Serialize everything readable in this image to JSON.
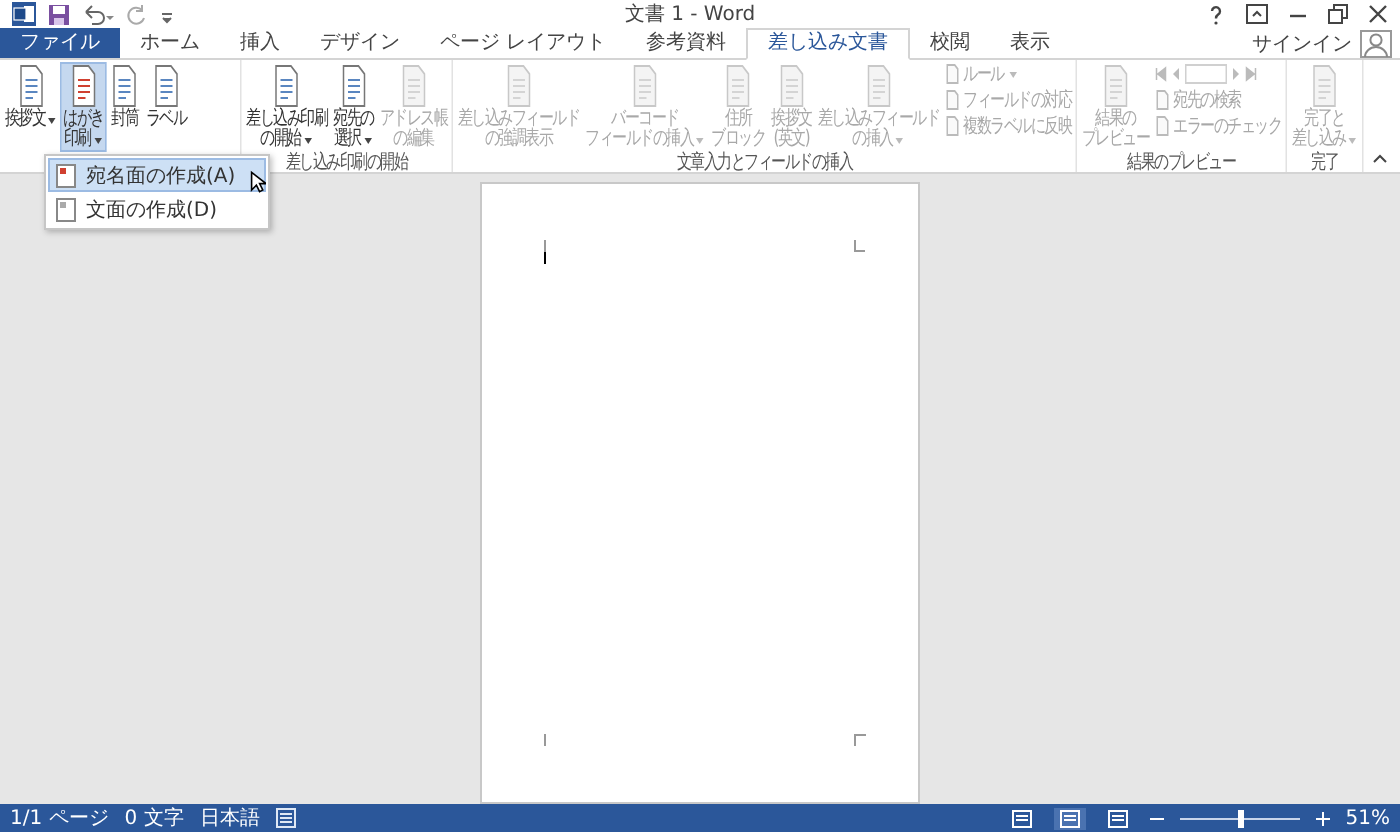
{
  "window": {
    "title": "文書 1 - Word",
    "sign_in": "サインイン"
  },
  "tabs": [
    {
      "label": "ファイル",
      "kind": "file",
      "selected": false
    },
    {
      "label": "ホーム",
      "kind": "tab",
      "selected": false
    },
    {
      "label": "挿入",
      "kind": "tab",
      "selected": false
    },
    {
      "label": "デザイン",
      "kind": "tab",
      "selected": false
    },
    {
      "label": "ページ レイアウト",
      "kind": "tab",
      "selected": false
    },
    {
      "label": "参考資料",
      "kind": "tab",
      "selected": false
    },
    {
      "label": "差し込み文書",
      "kind": "tab",
      "selected": true
    },
    {
      "label": "校閲",
      "kind": "tab",
      "selected": false
    },
    {
      "label": "表示",
      "kind": "tab",
      "selected": false
    }
  ],
  "ribbon": {
    "groups": [
      {
        "items": [
          {
            "kind": "large",
            "lines": [
              "挨拶文"
            ],
            "dropdown": true,
            "disabled": false,
            "selected": false
          },
          {
            "kind": "large",
            "lines": [
              "はがき",
              "印刷"
            ],
            "dropdown": true,
            "disabled": false,
            "selected": true
          },
          {
            "kind": "large",
            "lines": [
              "封筒"
            ],
            "dropdown": false,
            "disabled": false,
            "selected": false
          },
          {
            "kind": "large",
            "lines": [
              "ラベル"
            ],
            "dropdown": false,
            "disabled": false,
            "selected": false
          }
        ]
      },
      {
        "label": "差し込み印刷の開始",
        "items": [
          {
            "kind": "large",
            "lines": [
              "差し込み印刷",
              "の開始"
            ],
            "dropdown": true,
            "disabled": false,
            "selected": false
          },
          {
            "kind": "large",
            "lines": [
              "宛先の",
              "選択"
            ],
            "dropdown": true,
            "disabled": false,
            "selected": false
          },
          {
            "kind": "large",
            "lines": [
              "アドレス帳",
              "の編集"
            ],
            "dropdown": false,
            "disabled": true,
            "selected": false
          }
        ]
      },
      {
        "label": "文章入力とフィールドの挿入",
        "items": [
          {
            "kind": "large",
            "lines": [
              "差し込みフィールド",
              "の強調表示"
            ],
            "dropdown": false,
            "disabled": true,
            "selected": false
          },
          {
            "kind": "large",
            "lines": [
              "バーコード",
              "フィールドの挿入"
            ],
            "dropdown": true,
            "disabled": true,
            "selected": false
          },
          {
            "kind": "large",
            "lines": [
              "住所",
              "ブロック"
            ],
            "dropdown": false,
            "disabled": true,
            "selected": false
          },
          {
            "kind": "large",
            "lines": [
              "挨拶文",
              "(英文)"
            ],
            "dropdown": false,
            "disabled": true,
            "selected": false
          },
          {
            "kind": "large",
            "lines": [
              "差し込みフィールド",
              "の挿入"
            ],
            "dropdown": true,
            "disabled": true,
            "selected": false
          },
          {
            "kind": "stack",
            "entries": [
              {
                "text": "ルール",
                "dropdown": true,
                "disabled": true
              },
              {
                "text": "フィールドの対応",
                "dropdown": false,
                "disabled": true
              },
              {
                "text": "複数ラベルに反映",
                "dropdown": false,
                "disabled": true
              }
            ]
          }
        ]
      },
      {
        "label": "結果のプレビュー",
        "items": [
          {
            "kind": "large",
            "lines": [
              "結果の",
              "プレビュー"
            ],
            "dropdown": false,
            "disabled": true,
            "selected": false
          },
          {
            "kind": "nav",
            "disabled": true,
            "entries": [
              {
                "text": "宛先の検索",
                "dropdown": false,
                "disabled": true
              },
              {
                "text": "エラーのチェック",
                "dropdown": false,
                "disabled": true
              }
            ]
          }
        ]
      },
      {
        "label": "完了",
        "items": [
          {
            "kind": "large",
            "lines": [
              "完了と",
              "差し込み"
            ],
            "dropdown": true,
            "disabled": true,
            "selected": false
          }
        ]
      }
    ]
  },
  "menu": {
    "items": [
      {
        "text": "宛名面の作成(A)",
        "selected": true
      },
      {
        "text": "文面の作成(D)",
        "selected": false
      }
    ]
  },
  "status_bar": {
    "items": [
      "1/1 ページ",
      "0 文字",
      "日本語"
    ],
    "views": [
      {
        "selected": false
      },
      {
        "selected": true
      },
      {
        "selected": false
      }
    ],
    "zoom": {
      "level": 0.5,
      "reading": "51%"
    }
  }
}
